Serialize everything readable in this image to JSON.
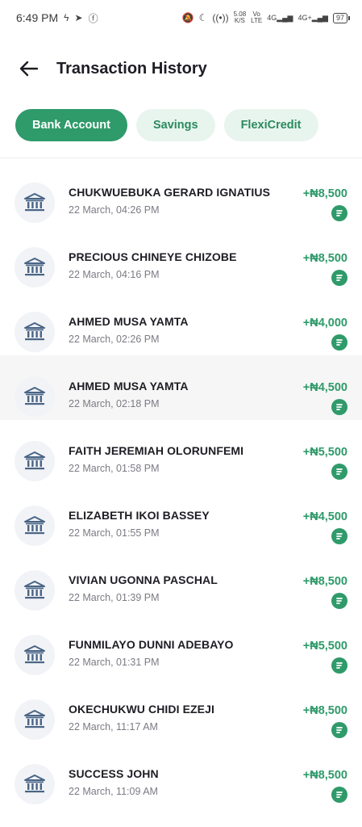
{
  "status_bar": {
    "time": "6:49 PM",
    "net_speed_top": "5.08",
    "net_speed_unit": "K/S",
    "volte_top": "Vo",
    "volte_bottom": "LTE",
    "net1": "4G",
    "net2": "4G+",
    "battery": "97"
  },
  "header": {
    "title": "Transaction History"
  },
  "tabs": [
    {
      "label": "Bank Account",
      "active": true
    },
    {
      "label": "Savings",
      "active": false
    },
    {
      "label": "FlexiCredit",
      "active": false
    }
  ],
  "colors": {
    "accent": "#2f9a6a",
    "tab_inactive_bg": "#e8f5ee",
    "icon_bg": "#f1f3f7",
    "bank_icon": "#4a6585"
  },
  "transactions": [
    {
      "name": "CHUKWUEBUKA GERARD IGNATIUS",
      "date": "22 March, 04:26 PM",
      "amount": "+₦8,500",
      "icon": "bank-icon"
    },
    {
      "name": "PRECIOUS CHINEYE CHIZOBE",
      "date": "22 March, 04:16 PM",
      "amount": "+₦8,500",
      "icon": "bank-icon"
    },
    {
      "name": "AHMED MUSA YAMTA",
      "date": "22 March, 02:26 PM",
      "amount": "+₦4,000",
      "icon": "bank-icon"
    },
    {
      "name": "AHMED MUSA YAMTA",
      "date": "22 March, 02:18 PM",
      "amount": "+₦4,500",
      "icon": "bank-icon"
    },
    {
      "name": "FAITH JEREMIAH OLORUNFEMI",
      "date": "22 March, 01:58 PM",
      "amount": "+₦5,500",
      "icon": "bank-icon"
    },
    {
      "name": "ELIZABETH IKOI BASSEY",
      "date": "22 March, 01:55 PM",
      "amount": "+₦4,500",
      "icon": "bank-icon"
    },
    {
      "name": "VIVIAN UGONNA PASCHAL",
      "date": "22 March, 01:39 PM",
      "amount": "+₦8,500",
      "icon": "bank-icon"
    },
    {
      "name": "FUNMILAYO DUNNI ADEBAYO",
      "date": "22 March, 01:31 PM",
      "amount": "+₦5,500",
      "icon": "bank-icon"
    },
    {
      "name": "OKECHUKWU CHIDI EZEJI",
      "date": "22 March, 11:17 AM",
      "amount": "+₦8,500",
      "icon": "bank-icon"
    },
    {
      "name": "SUCCESS JOHN",
      "date": "22 March, 11:09 AM",
      "amount": "+₦8,500",
      "icon": "bank-icon"
    }
  ]
}
